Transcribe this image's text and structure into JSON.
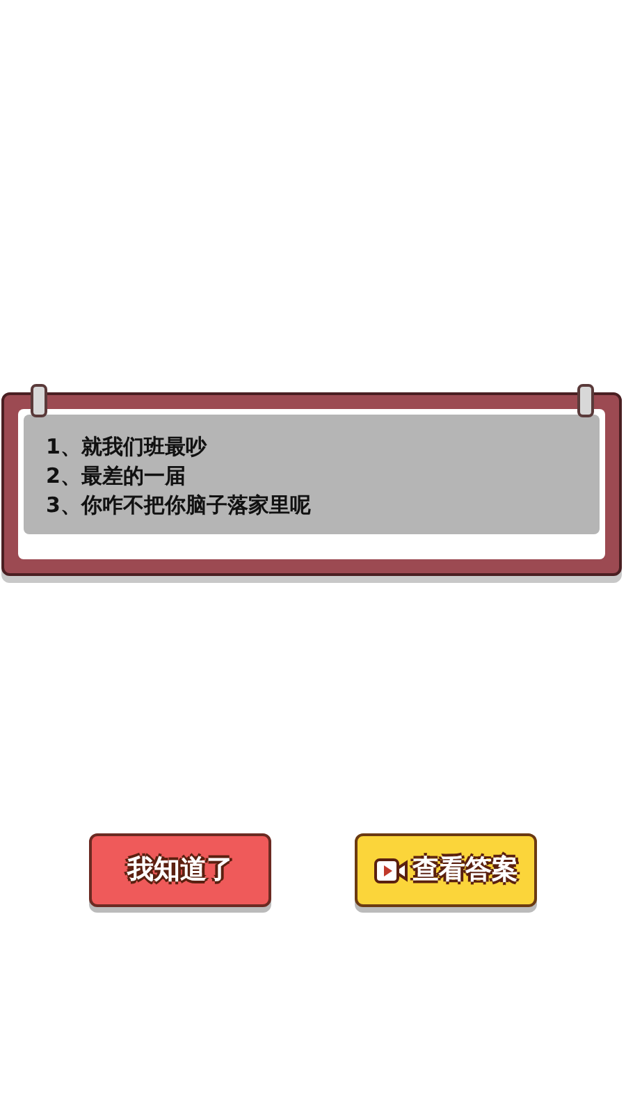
{
  "board": {
    "lines": [
      "1、就我们班最吵",
      "2、最差的一届",
      "3、你咋不把你脑子落家里呢"
    ]
  },
  "buttons": [
    {
      "kind": "plain",
      "label": "我知道了"
    },
    {
      "kind": "video",
      "label": "查看答案"
    }
  ]
}
